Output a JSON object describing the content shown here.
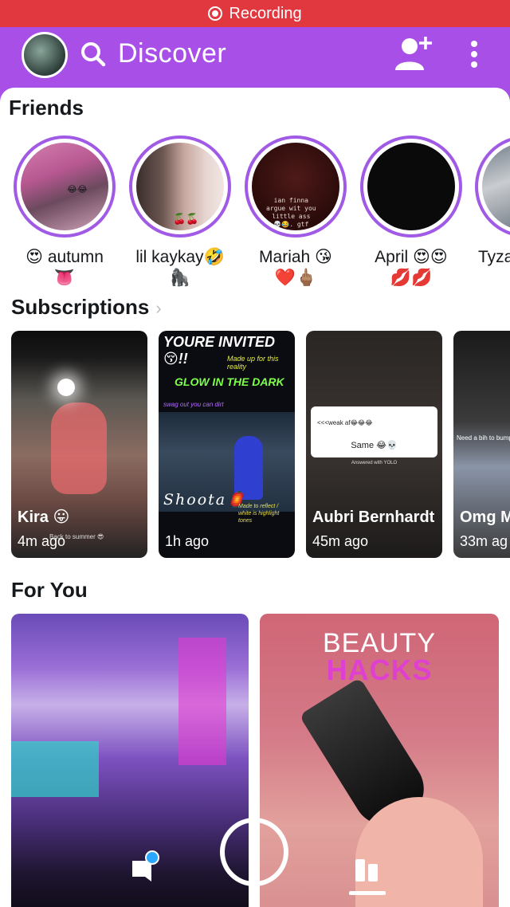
{
  "status_bar": {
    "recording_label": "Recording"
  },
  "header": {
    "title": "Discover",
    "avatar_icon": "bitmoji-avatar",
    "search_icon": "search-icon",
    "add_friend_icon": "add-friend-icon",
    "more_icon": "more-vertical-icon"
  },
  "friends": {
    "title": "Friends",
    "items": [
      {
        "name": "😍 autumn",
        "name2": "👅"
      },
      {
        "name": "lil kaykay🤣",
        "name2": "🦍"
      },
      {
        "name": "Mariah 😘",
        "name2": "❤️🖕🏽"
      },
      {
        "name": "April 😍😍",
        "name2": "💋💋"
      },
      {
        "name": "Tyza",
        "name2": ""
      }
    ],
    "story_texts": {
      "autumn": "😂😂",
      "kaykay": "🍒🍒",
      "mariah": "ian finna\nargue wit you\nlittle ass\n💀😂. gtf"
    }
  },
  "subscriptions": {
    "title": "Subscriptions",
    "items": [
      {
        "title": "Kira 😛",
        "time": "4m ago",
        "caption": "Back to summer 😎"
      },
      {
        "title": "",
        "time": "1h ago",
        "overlay_top": "YOURE INVITED😚!!",
        "overlay_sub": "Made up for this reality",
        "overlay_mid": "GLOW IN THE DARK",
        "overlay_small": "swag out you can dirt",
        "overlay_script": "Shoota🏮",
        "overlay_small2": "Made to reflect / white is highlight tones"
      },
      {
        "title": "Aubri Bernhardt",
        "time": "45m ago",
        "poll_question": "<<<weak af😂😂😂",
        "poll_answer": "Same 😂💀",
        "poll_footer": "Answered with YOLO"
      },
      {
        "title": "Omg M STORY",
        "time": "33m ag",
        "caption": "Need a bih to bump"
      }
    ]
  },
  "for_you": {
    "title": "For You",
    "beauty_line1": "BEAUTY",
    "beauty_line2": "HACKS"
  },
  "bottom_nav": {
    "chat_icon": "chat-icon",
    "capture_icon": "capture-button",
    "stories_icon": "stories-icon"
  }
}
